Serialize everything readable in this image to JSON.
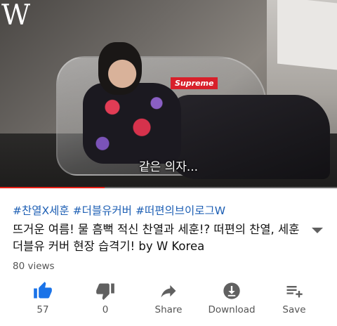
{
  "video": {
    "logo": "W",
    "brand_tag": "Supreme",
    "caption": "같은 의자...",
    "progress": 0.31,
    "progress_color": "#e62117"
  },
  "hashtags": [
    "#찬열X세훈",
    "#더블유커버",
    "#떠편의브이로그W"
  ],
  "hashtag_color": "#1d5fb4",
  "title": "뜨거운 여름! 물 흠뻑 적신 찬열과 세훈!? 떠편의 찬열, 세훈 더블유 커버 현장 습격기! by W Korea",
  "expand_icon": "chevron-down-icon",
  "views": "80 views",
  "actions": [
    {
      "name": "like",
      "label": "57",
      "icon": "thumbs-up-icon",
      "active": true
    },
    {
      "name": "dislike",
      "label": "0",
      "icon": "thumbs-down-icon",
      "active": false
    },
    {
      "name": "share",
      "label": "Share",
      "icon": "share-arrow-icon",
      "active": false
    },
    {
      "name": "download",
      "label": "Download",
      "icon": "download-icon",
      "active": false
    },
    {
      "name": "save",
      "label": "Save",
      "icon": "playlist-add-icon",
      "active": false
    }
  ],
  "accent_color": "#1a73e8",
  "icon_color": "#606060"
}
